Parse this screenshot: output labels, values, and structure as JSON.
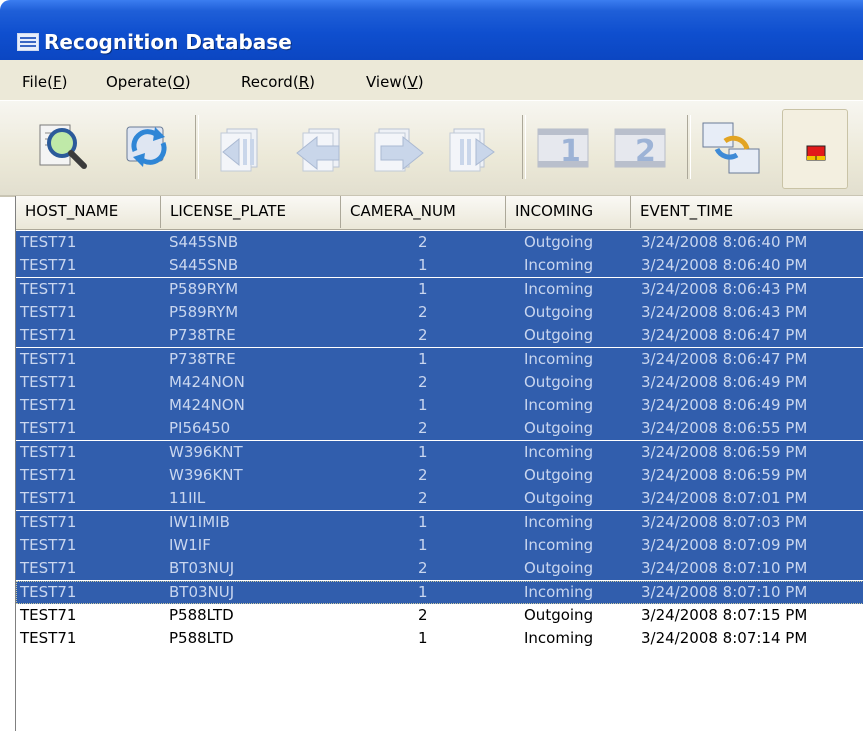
{
  "window": {
    "title": "Recognition Database"
  },
  "menu": [
    {
      "pre": "File(",
      "key": "F",
      "post": ")"
    },
    {
      "pre": "Operate(",
      "key": "O",
      "post": ")"
    },
    {
      "pre": "Record(",
      "key": "R",
      "post": ")"
    },
    {
      "pre": "View(",
      "key": "V",
      "post": ")"
    }
  ],
  "toolbar": [
    {
      "name": "search-icon"
    },
    {
      "name": "refresh-icon"
    },
    {
      "name": "first-record-icon"
    },
    {
      "name": "previous-record-icon"
    },
    {
      "name": "next-record-icon"
    },
    {
      "name": "last-record-icon"
    },
    {
      "name": "camera-1-icon"
    },
    {
      "name": "camera-2-icon"
    },
    {
      "name": "swap-icon"
    },
    {
      "name": "color-layout-icon"
    }
  ],
  "columns": [
    "HOST_NAME",
    "LICENSE_PLATE",
    "CAMERA_NUM",
    "INCOMING",
    "EVENT_TIME"
  ],
  "rows": [
    {
      "host": "TEST71",
      "plate": "S445SNB",
      "camera": "2",
      "incoming": "Outgoing",
      "time": "3/24/2008 8:06:40 PM",
      "selected": true
    },
    {
      "host": "TEST71",
      "plate": "S445SNB",
      "camera": "1",
      "incoming": "Incoming",
      "time": "3/24/2008 8:06:40 PM",
      "selected": true
    },
    {
      "host": "TEST71",
      "plate": "P589RYM",
      "camera": "1",
      "incoming": "Incoming",
      "time": "3/24/2008 8:06:43 PM",
      "selected": true
    },
    {
      "host": "TEST71",
      "plate": "P589RYM",
      "camera": "2",
      "incoming": "Outgoing",
      "time": "3/24/2008 8:06:43 PM",
      "selected": true
    },
    {
      "host": "TEST71",
      "plate": "P738TRE",
      "camera": "2",
      "incoming": "Outgoing",
      "time": "3/24/2008 8:06:47 PM",
      "selected": true
    },
    {
      "host": "TEST71",
      "plate": "P738TRE",
      "camera": "1",
      "incoming": "Incoming",
      "time": "3/24/2008 8:06:47 PM",
      "selected": true
    },
    {
      "host": "TEST71",
      "plate": "M424NON",
      "camera": "2",
      "incoming": "Outgoing",
      "time": "3/24/2008 8:06:49 PM",
      "selected": true
    },
    {
      "host": "TEST71",
      "plate": "M424NON",
      "camera": "1",
      "incoming": "Incoming",
      "time": "3/24/2008 8:06:49 PM",
      "selected": true
    },
    {
      "host": "TEST71",
      "plate": "PI56450",
      "camera": "2",
      "incoming": "Outgoing",
      "time": "3/24/2008 8:06:55 PM",
      "selected": true
    },
    {
      "host": "TEST71",
      "plate": "W396KNT",
      "camera": "1",
      "incoming": "Incoming",
      "time": "3/24/2008 8:06:59 PM",
      "selected": true
    },
    {
      "host": "TEST71",
      "plate": "W396KNT",
      "camera": "2",
      "incoming": "Outgoing",
      "time": "3/24/2008 8:06:59 PM",
      "selected": true
    },
    {
      "host": "TEST71",
      "plate": "11IIL",
      "camera": "2",
      "incoming": "Outgoing",
      "time": "3/24/2008 8:07:01 PM",
      "selected": true
    },
    {
      "host": "TEST71",
      "plate": "IW1IMIB",
      "camera": "1",
      "incoming": "Incoming",
      "time": "3/24/2008 8:07:03 PM",
      "selected": true
    },
    {
      "host": "TEST71",
      "plate": "IW1IF",
      "camera": "1",
      "incoming": "Incoming",
      "time": "3/24/2008 8:07:09 PM",
      "selected": true
    },
    {
      "host": "TEST71",
      "plate": "BT03NUJ",
      "camera": "2",
      "incoming": "Outgoing",
      "time": "3/24/2008 8:07:10 PM",
      "selected": true
    },
    {
      "host": "TEST71",
      "plate": "BT03NUJ",
      "camera": "1",
      "incoming": "Incoming",
      "time": "3/24/2008 8:07:10 PM",
      "selected": true,
      "focused": true
    },
    {
      "host": "TEST71",
      "plate": "P588LTD",
      "camera": "2",
      "incoming": "Outgoing",
      "time": "3/24/2008 8:07:15 PM",
      "selected": false
    },
    {
      "host": "TEST71",
      "plate": "P588LTD",
      "camera": "1",
      "incoming": "Incoming",
      "time": "3/24/2008 8:07:14 PM",
      "selected": false
    }
  ],
  "colors": {
    "title_bar": "#0b46c2",
    "selection": "#315ead",
    "face": "#ece9d8"
  }
}
